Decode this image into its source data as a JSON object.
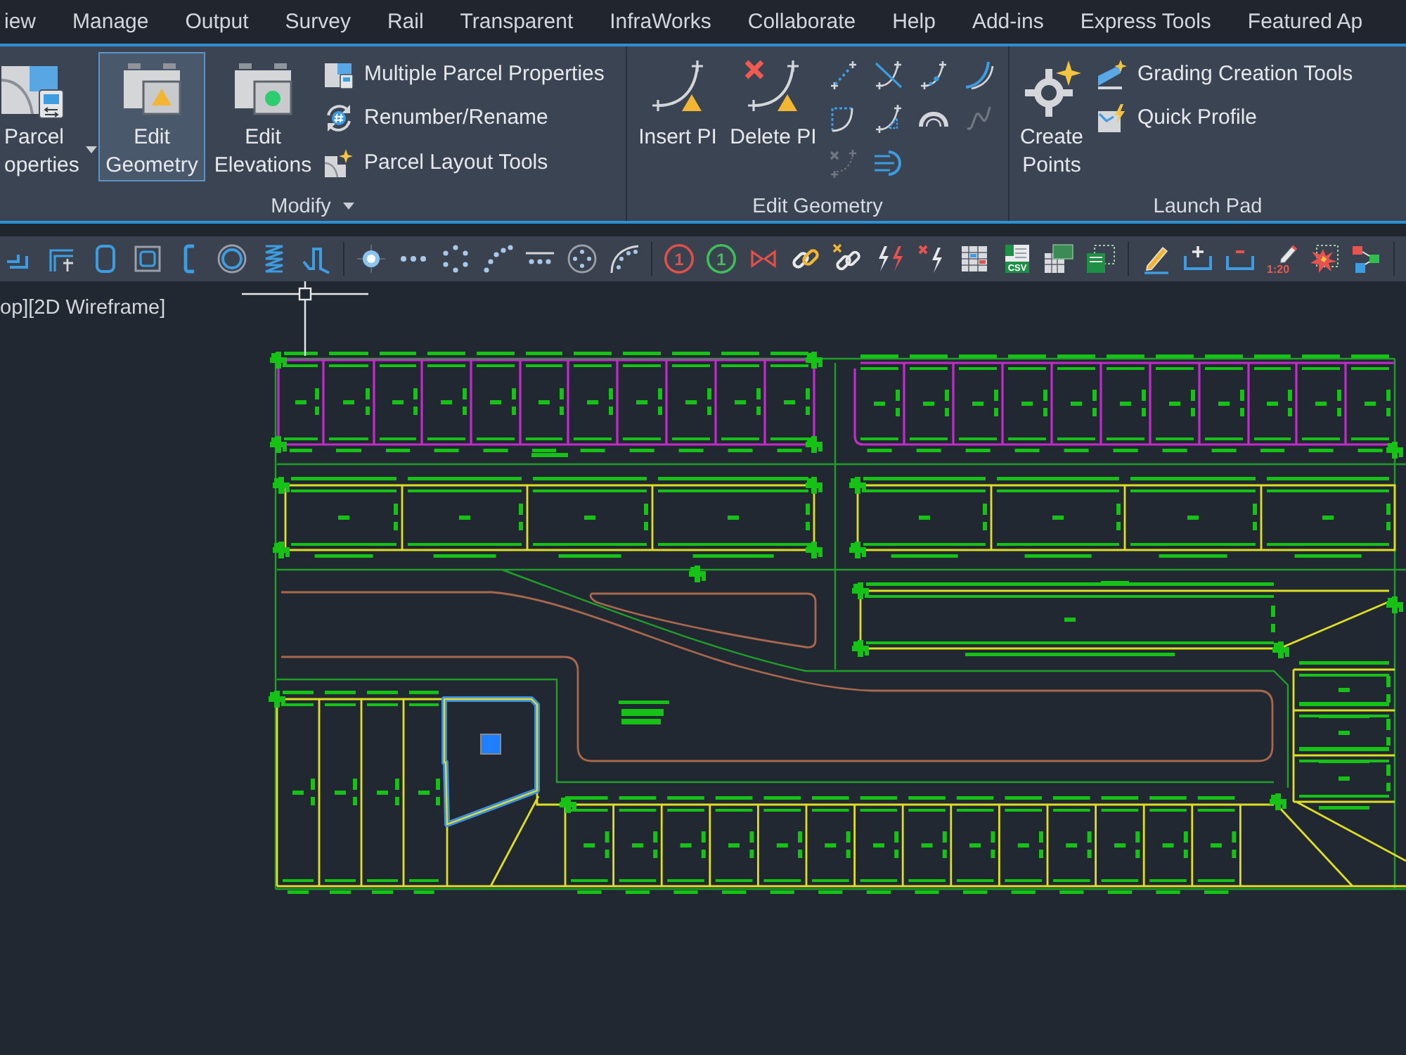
{
  "menu_tabs": [
    {
      "label": "iew"
    },
    {
      "label": "Manage"
    },
    {
      "label": "Output"
    },
    {
      "label": "Survey"
    },
    {
      "label": "Rail"
    },
    {
      "label": "Transparent"
    },
    {
      "label": "InfraWorks"
    },
    {
      "label": "Collaborate"
    },
    {
      "label": "Help"
    },
    {
      "label": "Add-ins"
    },
    {
      "label": "Express Tools"
    },
    {
      "label": "Featured Ap"
    }
  ],
  "ribbon": {
    "panels": [
      {
        "title": "Modify",
        "title_dropdown": true,
        "large_buttons": [
          {
            "label": "Parcel operties",
            "dropdown": true,
            "selected": false
          },
          {
            "label": "Edit Geometry",
            "selected": true
          },
          {
            "label": "Edit Elevations",
            "selected": false
          }
        ],
        "small_buttons": [
          {
            "label": "Multiple Parcel Properties"
          },
          {
            "label": "Renumber/Rename"
          },
          {
            "label": "Parcel Layout Tools"
          }
        ]
      },
      {
        "title": "Edit Geometry",
        "large_buttons": [
          {
            "label": "Insert PI",
            "selected": false
          },
          {
            "label": "Delete PI",
            "selected": false
          }
        ],
        "tool_grid": [
          {
            "disabled": false
          },
          {
            "disabled": false
          },
          {
            "disabled": false
          },
          {
            "disabled": false
          },
          {
            "disabled": false
          },
          {
            "disabled": false
          },
          {
            "disabled": false
          },
          {
            "disabled": true
          },
          {
            "disabled": true
          },
          {
            "disabled": false
          }
        ]
      },
      {
        "title": "Launch Pad",
        "large_buttons": [
          {
            "label": "Create Points",
            "selected": false
          }
        ],
        "small_buttons": [
          {
            "label": "Grading Creation Tools"
          },
          {
            "label": "Quick Profile"
          }
        ]
      }
    ]
  },
  "toolbar": {
    "icon_texts": [
      "1",
      "1",
      "CSV",
      "1:20"
    ]
  },
  "viewport": {
    "label": "op][2D Wireframe]",
    "parcel_selected": true
  }
}
